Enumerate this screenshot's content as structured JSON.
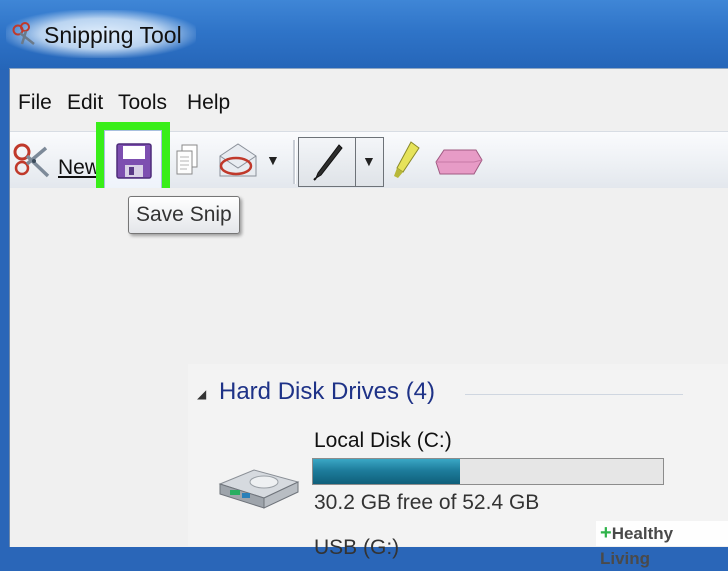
{
  "window": {
    "title": "Snipping Tool"
  },
  "menu": {
    "items": [
      "File",
      "Edit",
      "Tools",
      "Help"
    ]
  },
  "toolbar": {
    "new_label": "New",
    "icons": [
      "scissors-icon",
      "save-icon",
      "copy-icon",
      "send-snip-icon",
      "dropdown-arrow-icon",
      "pen-icon",
      "highlighter-icon",
      "eraser-icon"
    ],
    "highlight_color": "#39ee19"
  },
  "tooltip": {
    "text": "Save Snip"
  },
  "explorer": {
    "group_title": "Hard Disk Drives (4)",
    "drives": [
      {
        "name": "Local Disk (C:)",
        "free_text": "30.2 GB free of 52.4 GB",
        "used_fraction": 0.42,
        "bar_color": "#1e7d9c"
      },
      {
        "name": "USB (G:)"
      }
    ]
  },
  "watermark": {
    "plus": "+",
    "text": "Healthy Living"
  }
}
